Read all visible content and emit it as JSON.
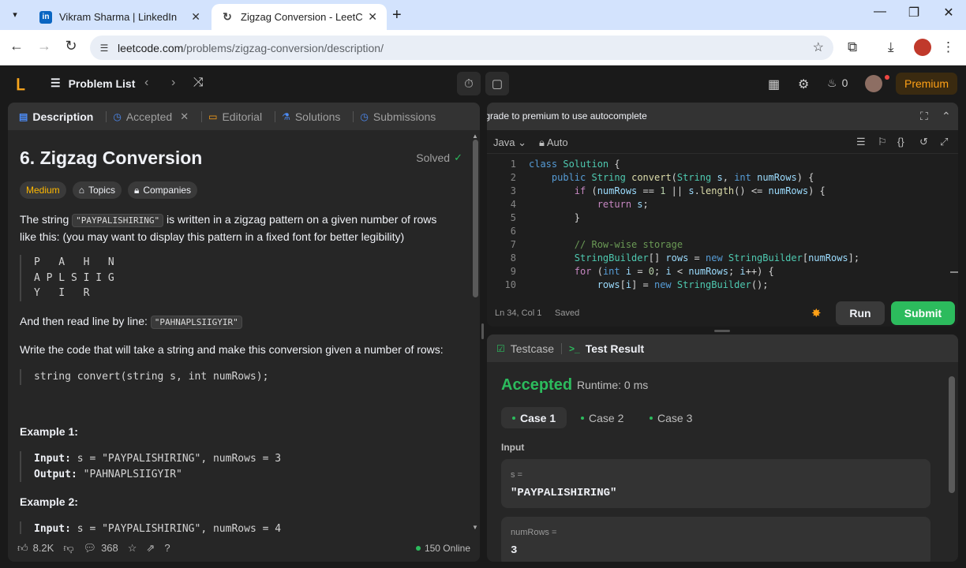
{
  "browser": {
    "tabs": [
      {
        "title": "Vikram Sharma | LinkedIn",
        "favicon": "linkedin-icon"
      },
      {
        "title": "Zigzag Conversion - LeetCode",
        "favicon": "leetcode-icon"
      }
    ],
    "url_host": "leetcode.com",
    "url_path": "/problems/zigzag-conversion/description/"
  },
  "nav": {
    "problem_list": "Problem List",
    "streak_count": "0",
    "premium": "Premium"
  },
  "left": {
    "tabs": {
      "description": "Description",
      "accepted": "Accepted",
      "editorial": "Editorial",
      "solutions": "Solutions",
      "submissions": "Submissions"
    },
    "title": "6. Zigzag Conversion",
    "solved": "Solved",
    "chips": {
      "difficulty": "Medium",
      "topics": "Topics",
      "companies": "Companies"
    },
    "p1_a": "The string ",
    "p1_code": "\"PAYPALISHIRING\"",
    "p1_b": " is written in a zigzag pattern on a given number of rows like this: (you may want to display this pattern in a fixed font for better legibility)",
    "pattern": "P   A   H   N\nA P L S I I G\nY   I   R",
    "p2_a": "And then read line by line: ",
    "p2_code": "\"PAHNAPLSIIGYIR\"",
    "p3": "Write the code that will take a string and make this conversion given a number of rows:",
    "signature": "string convert(string s, int numRows);",
    "example1_title": "Example 1:",
    "example1_input_label": "Input:",
    "example1_input": " s = \"PAYPALISHIRING\", numRows = 3",
    "example1_output_label": "Output:",
    "example1_output": " \"PAHNAPLSIIGYIR\"",
    "example2_title": "Example 2:",
    "example2_input_label": "Input:",
    "example2_input": " s = \"PAYPALISHIRING\", numRows = 4",
    "footer": {
      "likes": "8.2K",
      "comments": "368",
      "online": "150 Online"
    }
  },
  "editor": {
    "tooltip": "Upgrade to premium to use autocomplete",
    "language": "Java",
    "mode": "Auto",
    "line_numbers": [
      "1",
      "2",
      "3",
      "4",
      "5",
      "6",
      "7",
      "8",
      "9",
      "10"
    ],
    "status": "Ln 34, Col 1",
    "saved": "Saved",
    "run": "Run",
    "submit": "Submit"
  },
  "result": {
    "tab_testcase": "Testcase",
    "tab_result": "Test Result",
    "verdict": "Accepted",
    "runtime": "Runtime: 0 ms",
    "cases": [
      "Case 1",
      "Case 2",
      "Case 3"
    ],
    "input_label": "Input",
    "var1_name": "s =",
    "var1_value": "\"PAYPALISHIRING\"",
    "var2_name": "numRows =",
    "var2_value": "3"
  },
  "colors": {
    "accent_green": "#2cbb5d",
    "accent_orange": "#ffa116",
    "medium": "#ffb800"
  }
}
